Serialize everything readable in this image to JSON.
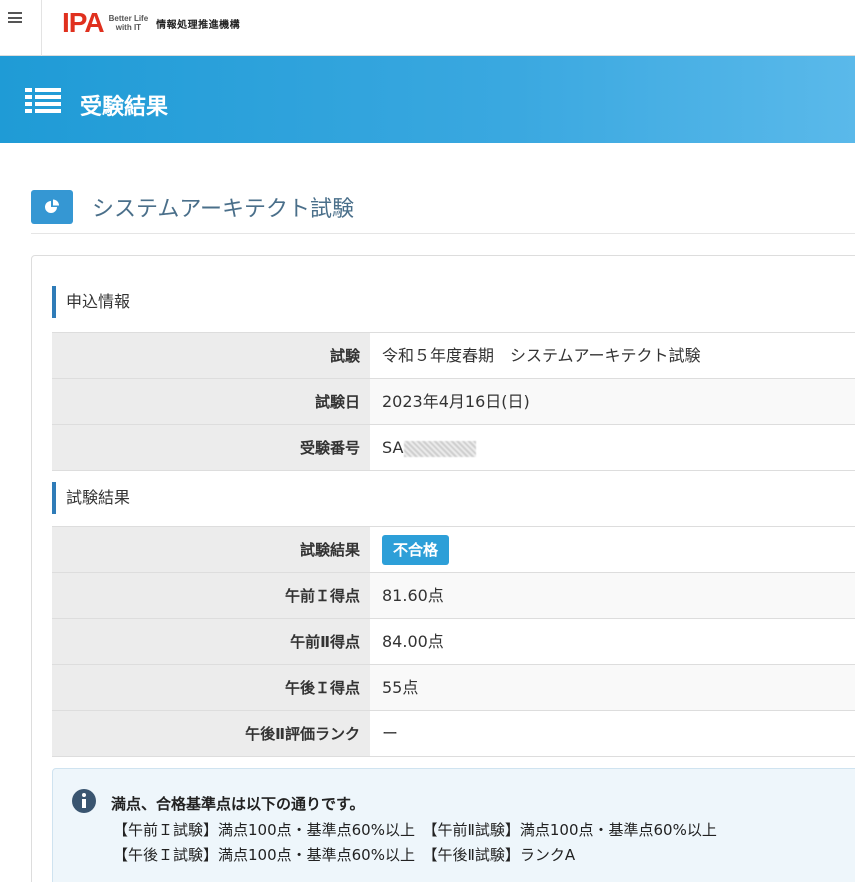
{
  "header": {
    "logo_text": "IPA",
    "logo_tagline_1": "Better Life",
    "logo_tagline_2": "with IT",
    "org_name": "情報処理推進機構"
  },
  "page": {
    "title": "受験結果"
  },
  "exam": {
    "title": "システムアーキテクト試験"
  },
  "application_section": {
    "heading": "申込情報",
    "rows": [
      {
        "label": "試験",
        "value": "令和５年度春期　システムアーキテクト試験"
      },
      {
        "label": "試験日",
        "value": "2023年4月16日(日)"
      },
      {
        "label": "受験番号",
        "value": "SA"
      }
    ]
  },
  "result_section": {
    "heading": "試験結果",
    "rows": [
      {
        "label": "試験結果",
        "value": "不合格"
      },
      {
        "label": "午前Ｉ得点",
        "value": "81.60点"
      },
      {
        "label": "午前Ⅱ得点",
        "value": "84.00点"
      },
      {
        "label": "午後Ｉ得点",
        "value": "55点"
      },
      {
        "label": "午後Ⅱ評価ランク",
        "value": "ー"
      }
    ]
  },
  "note": {
    "title": "満点、合格基準点は以下の通りです。",
    "line_1": "【午前Ｉ試験】満点100点・基準点60%以上　【午前Ⅱ試験】満点100点・基準点60%以上",
    "line_2": "【午後Ｉ試験】満点100点・基準点60%以上　【午後Ⅱ試験】ランクA"
  },
  "colors": {
    "band": "#1f9bd6",
    "badge": "#2d9fd8",
    "logo": "#e0301e"
  }
}
